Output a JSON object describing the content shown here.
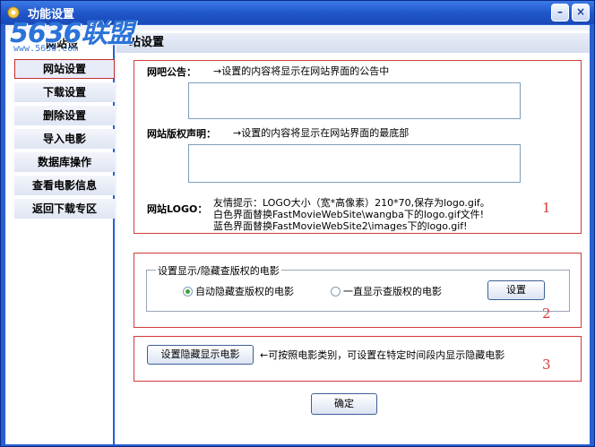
{
  "window": {
    "title": "功能设置"
  },
  "watermark": {
    "logo_num": "5636",
    "logo_cn": "联盟",
    "url": "www.5636.com"
  },
  "sidebar": {
    "header_fragment": "网站设",
    "items": [
      {
        "label": "网站设置",
        "active": true
      },
      {
        "label": "下载设置"
      },
      {
        "label": "删除设置"
      },
      {
        "label": "导入电影"
      },
      {
        "label": "数据库操作"
      },
      {
        "label": "查看电影信息"
      },
      {
        "label": "返回下载专区"
      }
    ]
  },
  "main": {
    "page_title_fragment": "站设置",
    "section1": {
      "notice_label": "网吧公告：",
      "notice_hint": "→设置的内容将显示在网站界面的公告中",
      "notice_value": "",
      "copyright_label": "网站版权声明：",
      "copyright_hint": "→设置的内容将显示在网站界面的最底部",
      "copyright_value": "",
      "logo_label": "网站LOGO：",
      "logo_tip_1": "友情提示：LOGO大小（宽*高像素）210*70,保存为logo.gif。",
      "logo_tip_2": "白色界面替换FastMovieWebSite\\wangba下的logo.gif文件!",
      "logo_tip_3": "蓝色界面替换FastMovieWebSite2\\images下的logo.gif!",
      "number": "1"
    },
    "section2": {
      "group_title": "设置显示/隐藏查版权的电影",
      "option_hide": "自动隐藏查版权的电影",
      "option_show": "一直显示查版权的电影",
      "selected": "自动隐藏查版权的电影",
      "set_button": "设置",
      "number": "2"
    },
    "section3": {
      "button": "设置隐藏显示电影",
      "hint": "←可按照电影类别，可设置在特定时间段内显示隐藏电影",
      "number": "3"
    },
    "ok_button": "确定"
  },
  "colors": {
    "accent": "#2a5fd0",
    "annotation_red": "#d23b3b"
  }
}
